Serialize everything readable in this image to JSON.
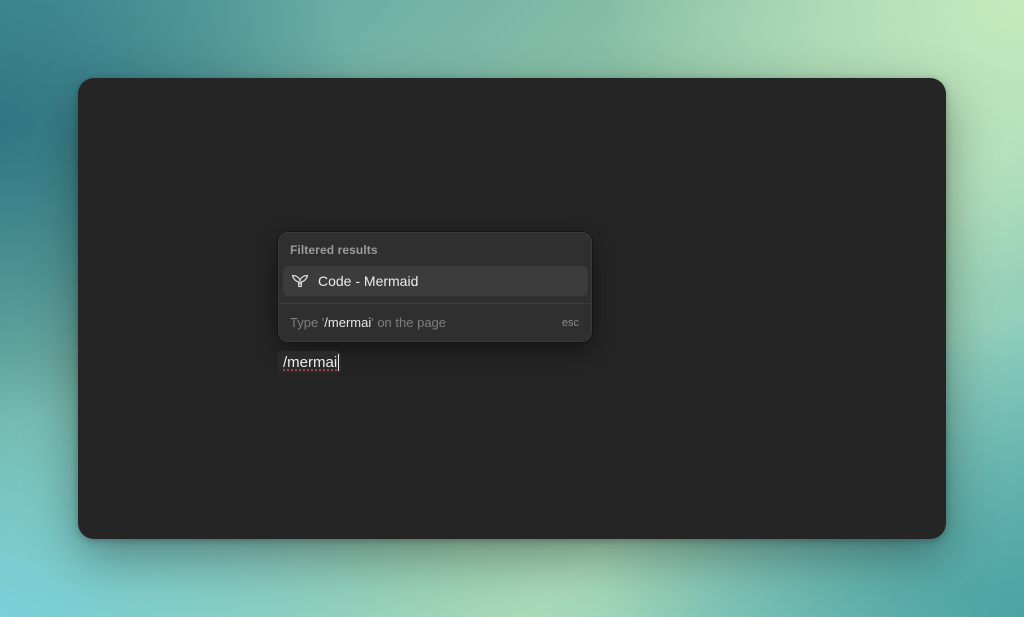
{
  "command_menu": {
    "header": "Filtered results",
    "items": [
      {
        "label": "Code - Mermaid",
        "icon": "mermaid-tail-icon",
        "highlighted": true
      }
    ],
    "footer": {
      "hint_prefix": "Type '",
      "hint_query": "/mermai",
      "hint_suffix": "' on the page",
      "dismiss_key": "esc"
    }
  },
  "editor": {
    "current_text": "/mermai"
  },
  "colors": {
    "window_background": "#252525",
    "menu_background": "#2f2f2f",
    "item_highlight": "#3c3c3c",
    "spellcheck_underline": "#c0504d"
  }
}
